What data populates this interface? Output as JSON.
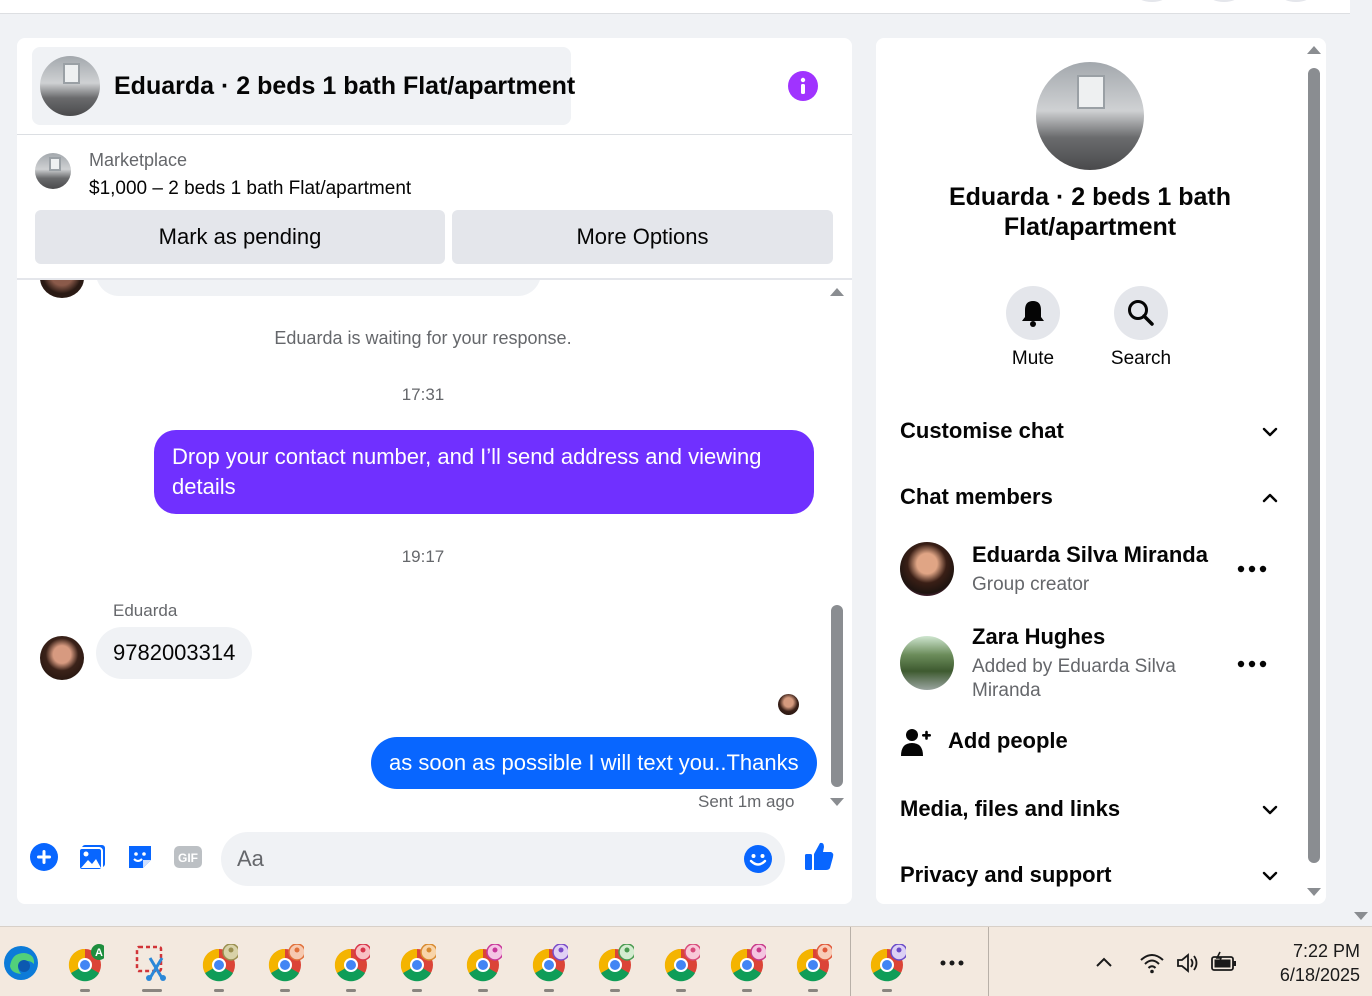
{
  "chat": {
    "title": "Eduarda · 2 beds 1 bath Flat/apartment",
    "marketplace_label": "Marketplace",
    "listing": "$1,000 – 2 beds 1 bath Flat/apartment",
    "mark_pending": "Mark as pending",
    "more_options": "More Options",
    "waiting_notice": "Eduarda is waiting for your response.",
    "timestamp_1": "17:31",
    "message_out_1": "Drop your contact number, and I’ll send address and viewing details",
    "timestamp_2": "19:17",
    "sender_name": "Eduarda",
    "message_in_1": "9782003314",
    "message_out_2": "as soon as possible I will text you..Thanks",
    "sent_status": "Sent 1m ago",
    "composer_placeholder": "Aa"
  },
  "side": {
    "title": "Eduarda · 2 beds 1 bath Flat/apartment",
    "mute": "Mute",
    "search": "Search",
    "customise_chat": "Customise chat",
    "chat_members": "Chat members",
    "members": [
      {
        "name": "Eduarda Silva Miranda",
        "role": "Group creator"
      },
      {
        "name": "Zara Hughes",
        "role": "Added by Eduarda Silva Miranda"
      }
    ],
    "add_people": "Add people",
    "media_files_links": "Media, files and links",
    "privacy_support": "Privacy and support"
  },
  "taskbar": {
    "time": "7:22 PM",
    "date": "6/18/2025"
  },
  "colors": {
    "accent_purple": "#7030ff",
    "accent_blue": "#0866ff",
    "info_icon": "#a033ff"
  }
}
